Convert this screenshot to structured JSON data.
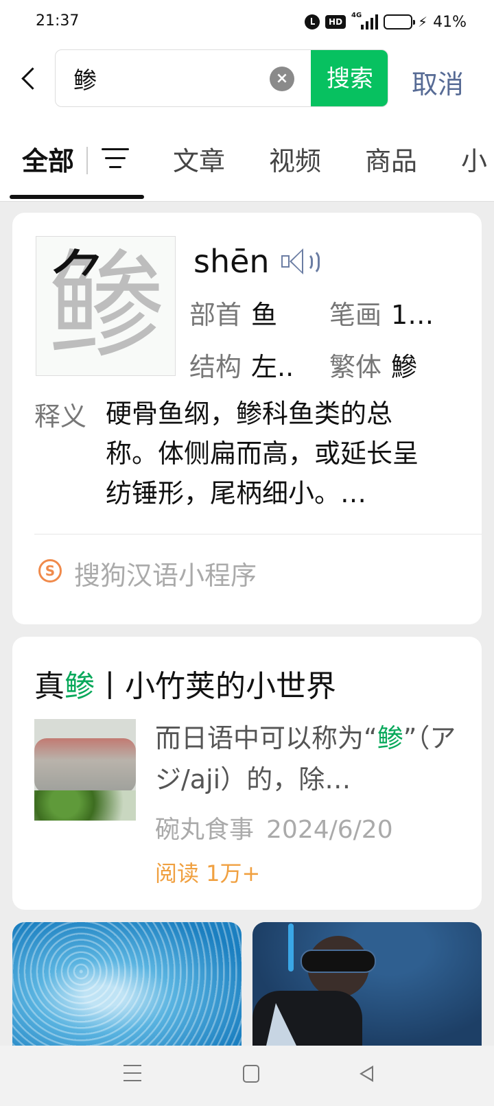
{
  "status_bar": {
    "time": "21:37",
    "network": "4G",
    "battery_percent": "41%",
    "battery_level": 0.41,
    "icons": [
      "alarm-icon",
      "hd-icon",
      "signal-icon",
      "battery-icon",
      "charging-icon"
    ]
  },
  "search": {
    "query": "鲹",
    "search_button": "搜索",
    "cancel_button": "取消"
  },
  "tabs": {
    "items": [
      "全部",
      "文章",
      "视频",
      "商品",
      "小"
    ],
    "active": "全部"
  },
  "dictionary": {
    "character": "鲹",
    "pinyin": "shēn",
    "radical_label": "部首",
    "radical_value": "鱼",
    "strokes_label": "笔画",
    "strokes_value": "1…",
    "structure_label": "结构",
    "structure_value": "左..",
    "traditional_label": "繁体",
    "traditional_value": "鰺",
    "definition_label": "释义",
    "definition_text": "硬骨鱼纲，鲹科鱼类的总称。体侧扁而高，或延长呈纺锤形，尾柄细小。…",
    "source": "搜狗汉语小程序"
  },
  "article": {
    "title_prefix": "真",
    "title_highlight": "鲹",
    "title_suffix": "丨小竹荚的小世界",
    "snippet_prefix": "而日语中可以称为“",
    "snippet_highlight": "鲹",
    "snippet_suffix": "”（アジ/aji）的，除…",
    "account": "碗丸食事",
    "date": "2024/6/20",
    "reads": "阅读 1万+"
  },
  "colors": {
    "accent_green": "#07c160",
    "link_blue": "#576b95",
    "read_orange": "#f0a040",
    "highlight_green": "#07a85a"
  }
}
